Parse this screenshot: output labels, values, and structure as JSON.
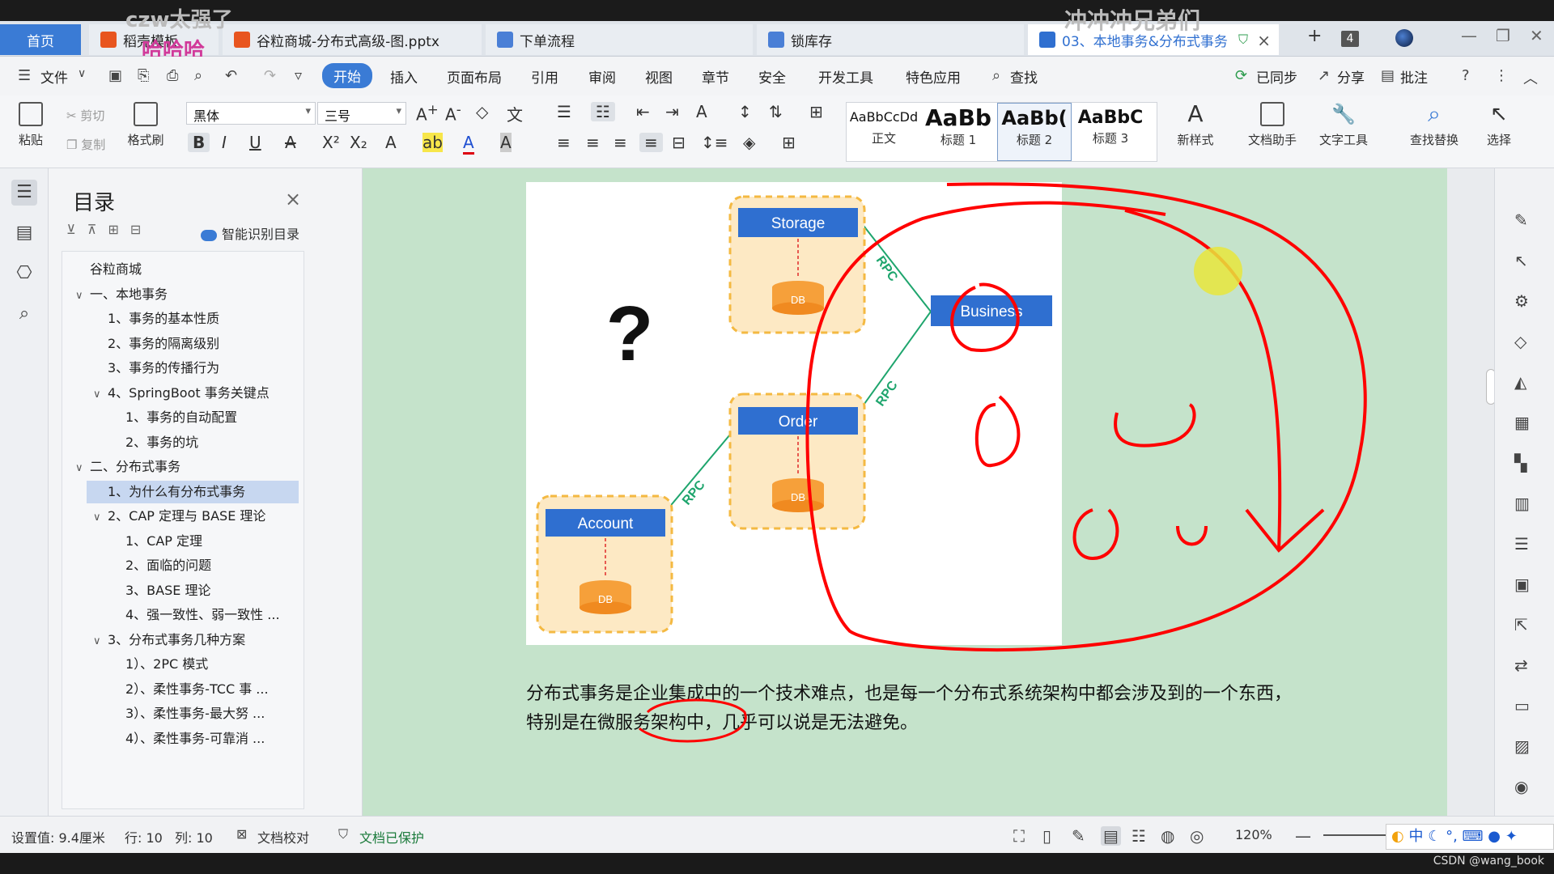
{
  "tabs": {
    "home": "首页",
    "t1": "稻壳模板",
    "t2": "谷粒商城-分布式高级-图.pptx",
    "t3": "下单流程",
    "t4": "锁库存",
    "t5": "03、本地事务&分布式事务"
  },
  "overlays": {
    "o1": "czw太强了",
    "o2": "哈哈哈",
    "o3": "冲冲冲兄弟们"
  },
  "tab_count": "4",
  "menu": {
    "file": "文件",
    "items": [
      "开始",
      "插入",
      "页面布局",
      "引用",
      "审阅",
      "视图",
      "章节",
      "安全",
      "开发工具",
      "特色应用"
    ],
    "search": "查找",
    "synced": "已同步",
    "share": "分享",
    "comment": "批注"
  },
  "ribbon": {
    "paste": "粘贴",
    "cut": "剪切",
    "copy": "复制",
    "format_painter": "格式刷",
    "font_name": "黑体",
    "font_size": "三号",
    "styles": [
      {
        "preview": "AaBbCcDd",
        "label": "正文"
      },
      {
        "preview": "AaBb",
        "label": "标题 1"
      },
      {
        "preview": "AaBb(",
        "label": "标题 2"
      },
      {
        "preview": "AaBbC",
        "label": "标题 3"
      }
    ],
    "new_style": "新样式",
    "doc_helper": "文档助手",
    "text_tools": "文字工具",
    "find_replace": "查找替换",
    "select": "选择"
  },
  "toc": {
    "title": "目录",
    "smart": "智能识别目录",
    "items": [
      {
        "text": "谷粒商城",
        "level": 0,
        "arrow": ""
      },
      {
        "text": "一、本地事务",
        "level": 0,
        "arrow": "∨"
      },
      {
        "text": "1、事务的基本性质",
        "level": 1,
        "arrow": ""
      },
      {
        "text": "2、事务的隔离级别",
        "level": 1,
        "arrow": ""
      },
      {
        "text": "3、事务的传播行为",
        "level": 1,
        "arrow": ""
      },
      {
        "text": "4、SpringBoot 事务关键点",
        "level": 1,
        "arrow": "∨"
      },
      {
        "text": "1、事务的自动配置",
        "level": 2,
        "arrow": ""
      },
      {
        "text": "2、事务的坑",
        "level": 2,
        "arrow": ""
      },
      {
        "text": "二、分布式事务",
        "level": 0,
        "arrow": "∨"
      },
      {
        "text": "1、为什么有分布式事务",
        "level": 1,
        "arrow": "",
        "active": true
      },
      {
        "text": "2、CAP 定理与 BASE 理论",
        "level": 1,
        "arrow": "∨"
      },
      {
        "text": "1、CAP 定理",
        "level": 2,
        "arrow": ""
      },
      {
        "text": "2、面临的问题",
        "level": 2,
        "arrow": ""
      },
      {
        "text": "3、BASE 理论",
        "level": 2,
        "arrow": ""
      },
      {
        "text": "4、强一致性、弱一致性 ...",
        "level": 2,
        "arrow": ""
      },
      {
        "text": "3、分布式事务几种方案",
        "level": 1,
        "arrow": "∨"
      },
      {
        "text": "1）、2PC 模式",
        "level": 2,
        "arrow": ""
      },
      {
        "text": "2）、柔性事务-TCC 事 ...",
        "level": 2,
        "arrow": ""
      },
      {
        "text": "3）、柔性事务-最大努 ...",
        "level": 2,
        "arrow": ""
      },
      {
        "text": "4）、柔性事务-可靠消 ...",
        "level": 2,
        "arrow": ""
      }
    ]
  },
  "diagram": {
    "storage": "Storage",
    "order": "Order",
    "account": "Account",
    "business": "Business",
    "db": "DB",
    "rpc": "RPC",
    "question": "?"
  },
  "paragraph": "分布式事务是企业集成中的一个技术难点，也是每一个分布式系统架构中都会涉及到的一个东西，特别是在微服务架构中，几乎可以说是无法避免。",
  "status": {
    "setting": "设置值: 9.4厘米",
    "row": "行: 10",
    "col": "列: 10",
    "proof": "文档校对",
    "protected": "文档已保护",
    "zoom": "120%",
    "ime": "中"
  },
  "watermark": "CSDN @wang_book",
  "colors": {
    "accent": "#3a7bd5",
    "annotation": "#ff0000",
    "page": "#c5e3cb",
    "node": "#2f6fd0",
    "db": "#f6a03a"
  }
}
